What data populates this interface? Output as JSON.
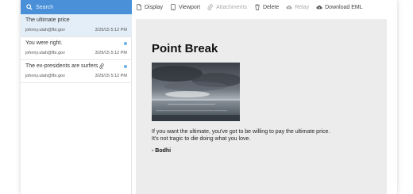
{
  "search": {
    "placeholder": "Search"
  },
  "messages": [
    {
      "subject": "The ultimate price",
      "sender": "johnny.utah@fbi.gov",
      "date": "3/29/15 5:12 PM"
    },
    {
      "subject": "You were right.",
      "sender": "johnny.utah@fbi.gov",
      "date": "3/29/15 5:12 PM"
    },
    {
      "subject": "The ex-presidents are surfers",
      "sender": "johnny.utah@fbi.gov",
      "date": "3/29/15 5:12 PM"
    }
  ],
  "toolbar": {
    "display": "Display",
    "viewport": "Viewport",
    "attachments": "Attachments",
    "delete": "Delete",
    "relay": "Relay",
    "download": "Download EML"
  },
  "email": {
    "title": "Point Break",
    "line1": "If you want the ultimate, you've got to be willing to pay the ultimate price.",
    "line2": "It's not tragic to die doing what you love.",
    "signature": "- Bodhi"
  },
  "colors": {
    "accent": "#4a90d9",
    "selected_row": "#e4eef8",
    "unread_dot": "#6aaee8",
    "content_bg": "#ececec"
  }
}
